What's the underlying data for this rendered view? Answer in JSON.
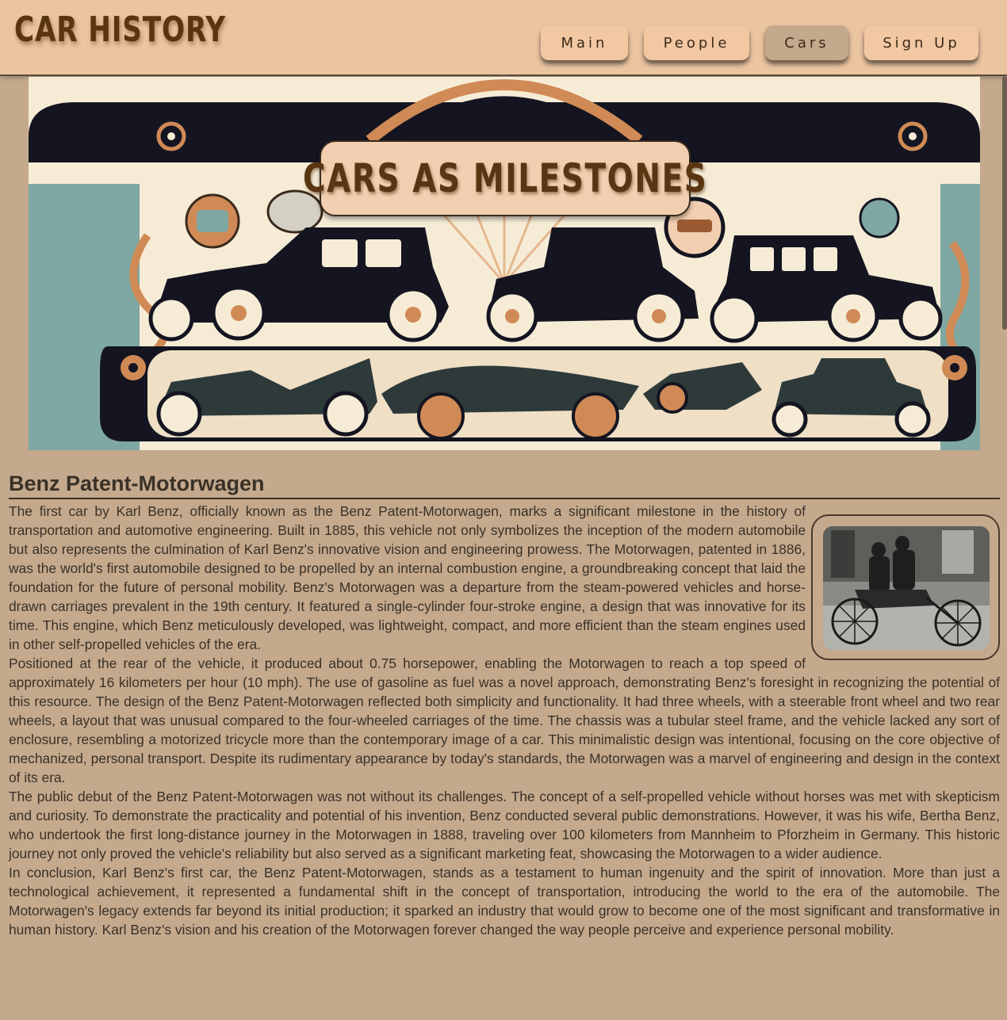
{
  "header": {
    "site_title": "CAR HISTORY",
    "nav": [
      {
        "label": "Main",
        "active": false
      },
      {
        "label": "People",
        "active": false
      },
      {
        "label": "Cars",
        "active": true
      },
      {
        "label": "Sign Up",
        "active": false
      }
    ]
  },
  "banner": {
    "title": "CARS AS MILESTONES"
  },
  "article": {
    "title": "Benz Patent-Motorwagen",
    "paragraphs": [
      "The first car by Karl Benz, officially known as the Benz Patent-Motorwagen, marks a significant milestone in the history of transportation and automotive engineering. Built in 1885, this vehicle not only symbolizes the inception of the modern automobile but also represents the culmination of Karl Benz's innovative vision and engineering prowess. The Motorwagen, patented in 1886, was the world's first automobile designed to be propelled by an internal combustion engine, a groundbreaking concept that laid the foundation for the future of personal mobility. Benz's Motorwagen was a departure from the steam-powered vehicles and horse-drawn carriages prevalent in the 19th century. It featured a single-cylinder four-stroke engine, a design that was innovative for its time. This engine, which Benz meticulously developed, was lightweight, compact, and more efficient than the steam engines used in other self-propelled vehicles of the era.",
      "Positioned at the rear of the vehicle, it produced about 0.75 horsepower, enabling the Motorwagen to reach a top speed of approximately 16 kilometers per hour (10 mph). The use of gasoline as fuel was a novel approach, demonstrating Benz's foresight in recognizing the potential of this resource. The design of the Benz Patent-Motorwagen reflected both simplicity and functionality. It had three wheels, with a steerable front wheel and two rear wheels, a layout that was unusual compared to the four-wheeled carriages of the time. The chassis was a tubular steel frame, and the vehicle lacked any sort of enclosure, resembling a motorized tricycle more than the contemporary image of a car. This minimalistic design was intentional, focusing on the core objective of mechanized, personal transport. Despite its rudimentary appearance by today's standards, the Motorwagen was a marvel of engineering and design in the context of its era.",
      "The public debut of the Benz Patent-Motorwagen was not without its challenges. The concept of a self-propelled vehicle without horses was met with skepticism and curiosity. To demonstrate the practicality and potential of his invention, Benz conducted several public demonstrations. However, it was his wife, Bertha Benz, who undertook the first long-distance journey in the Motorwagen in 1888, traveling over 100 kilometers from Mannheim to Pforzheim in Germany. This historic journey not only proved the vehicle's reliability but also served as a significant marketing feat, showcasing the Motorwagen to a wider audience.",
      "In conclusion, Karl Benz's first car, the Benz Patent-Motorwagen, stands as a testament to human ingenuity and the spirit of innovation. More than just a technological achievement, it represented a fundamental shift in the concept of transportation, introducing the world to the era of the automobile. The Motorwagen's legacy extends far beyond its initial production; it sparked an industry that would grow to become one of the most significant and transformative in human history. Karl Benz's vision and his creation of the Motorwagen forever changed the way people perceive and experience personal mobility."
    ]
  },
  "colors": {
    "page_bg": "#c4a98d",
    "header_bg": "#ebc4a0",
    "title_brown": "#5a3512",
    "text": "#3a3127"
  }
}
